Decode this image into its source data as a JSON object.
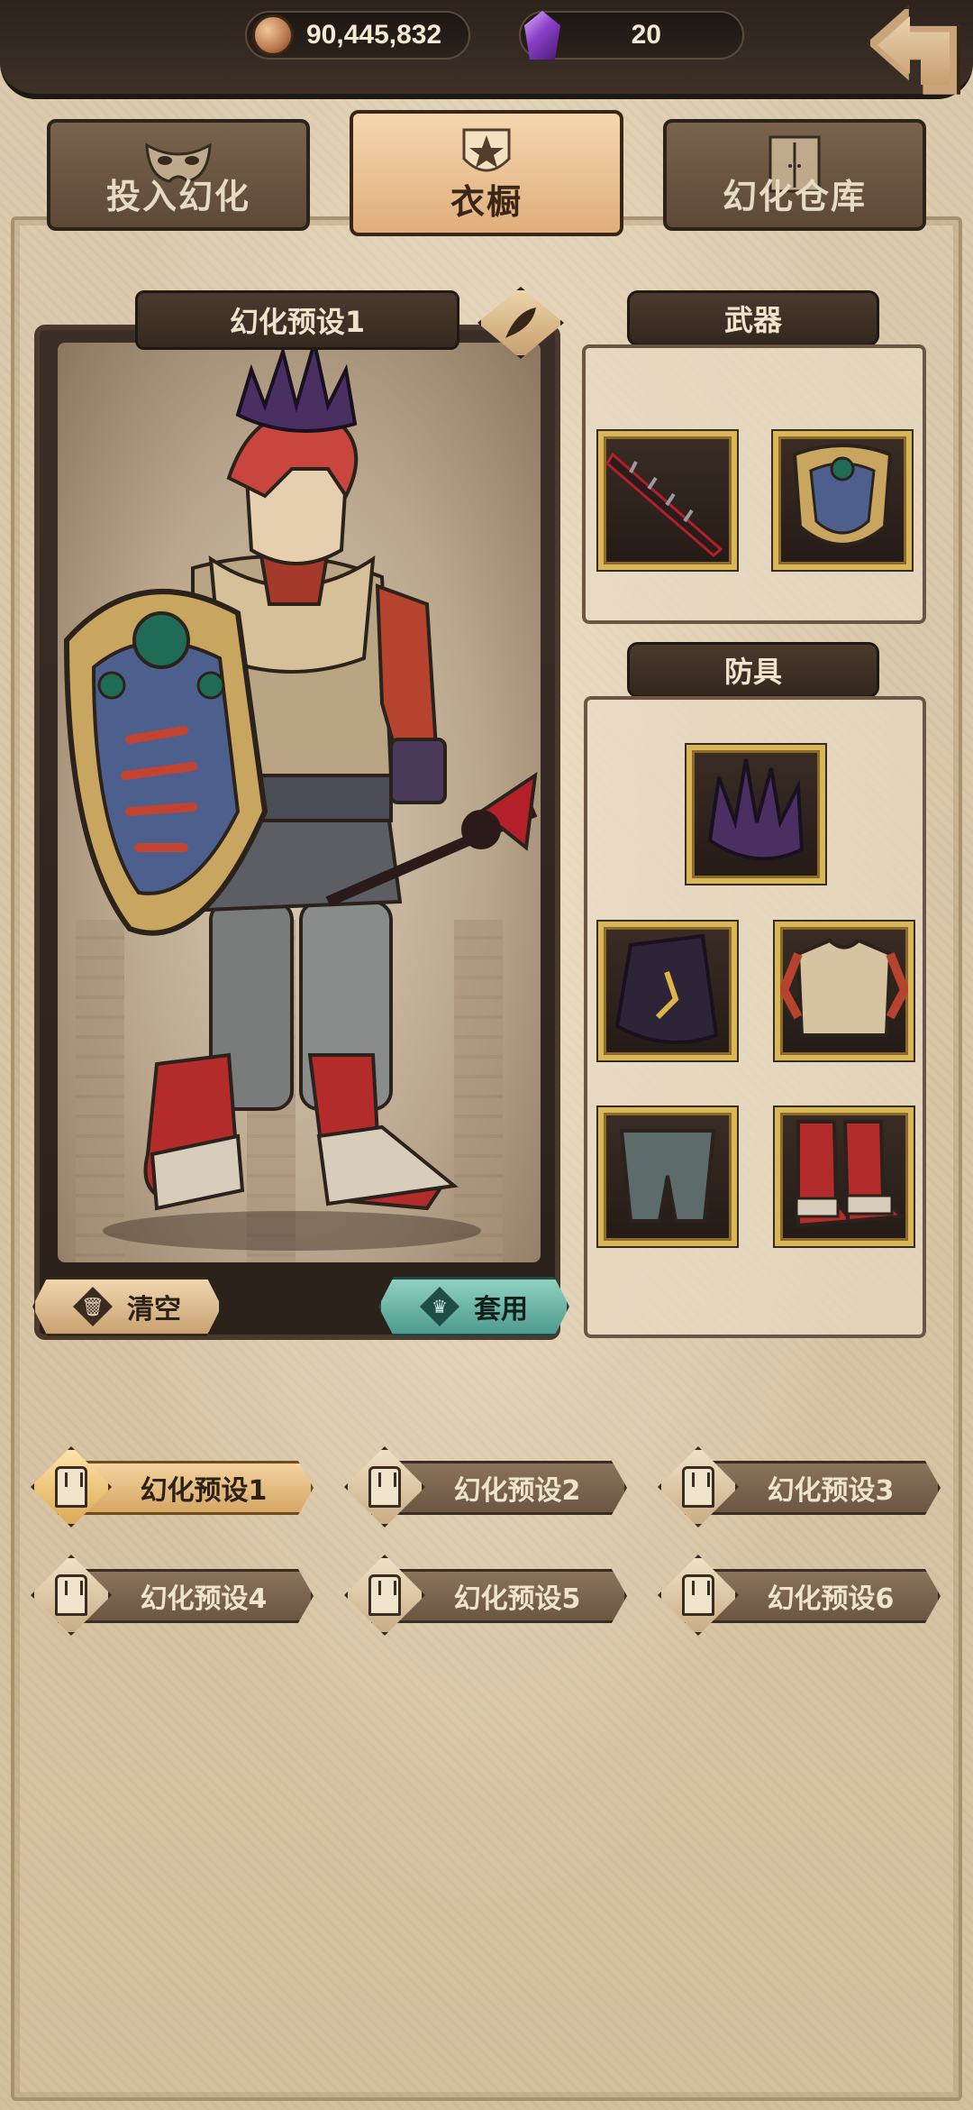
{
  "resources": {
    "coins": "90,445,832",
    "gems": "20"
  },
  "tabs": [
    {
      "label": "投入幻化",
      "active": false
    },
    {
      "label": "衣橱",
      "active": true
    },
    {
      "label": "幻化仓库",
      "active": false
    }
  ],
  "preset_panel": {
    "title": "幻化预设1",
    "clear_label": "清空",
    "apply_label": "套用"
  },
  "weapons": {
    "title": "武器",
    "items": [
      "spiked-sword",
      "jeweled-shield"
    ]
  },
  "armor": {
    "title": "防具",
    "items": [
      "spiked-crown",
      "dark-hood",
      "plate-chest",
      "grey-leg-armor",
      "red-boots"
    ]
  },
  "presets": [
    {
      "label": "幻化预设1",
      "active": true
    },
    {
      "label": "幻化预设2",
      "active": false
    },
    {
      "label": "幻化预设3",
      "active": false
    },
    {
      "label": "幻化预设4",
      "active": false
    },
    {
      "label": "幻化预设5",
      "active": false
    },
    {
      "label": "幻化预设6",
      "active": false
    }
  ],
  "colors": {
    "accent_gold": "#d9b65a",
    "active_tab": "#e0ae7b",
    "apply_teal": "#4e9b8d",
    "panel_dark": "#33271e"
  }
}
